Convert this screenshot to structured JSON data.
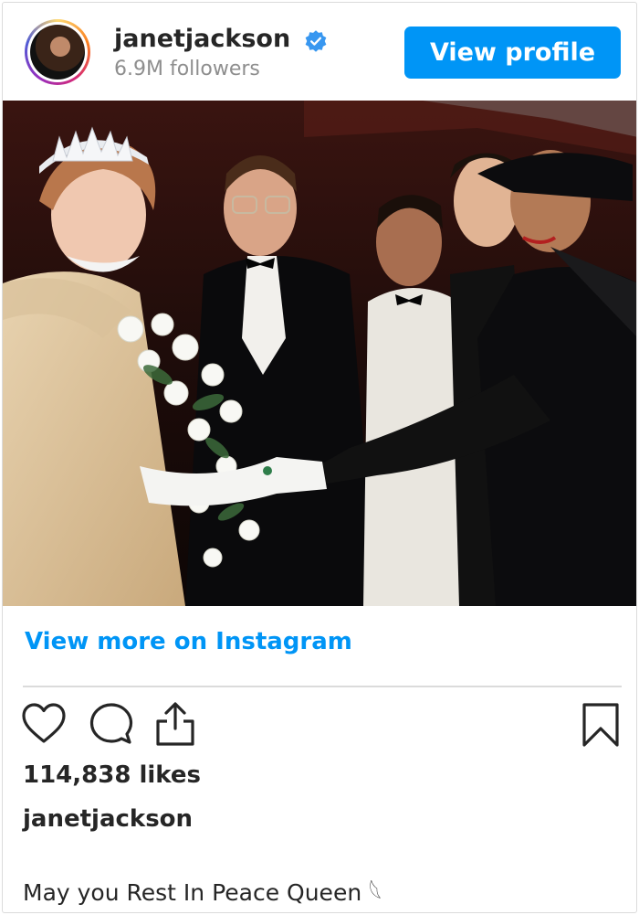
{
  "post": {
    "username": "janetjackson",
    "followers": "6.9M followers",
    "view_profile_label": "View profile",
    "view_more_label": "View more on Instagram",
    "likes": "114,838 likes",
    "caption_username": "janetjackson",
    "caption": "May you Rest In Peace Queen 𓆩"
  },
  "icons": {
    "verified": "verified-badge-icon",
    "like": "heart-icon",
    "comment": "comment-bubble-icon",
    "share": "share-upload-icon",
    "save": "bookmark-icon"
  },
  "colors": {
    "accent": "#0095f6",
    "text": "#262626",
    "muted": "#8e8e8e",
    "border": "#dbdbdb"
  }
}
